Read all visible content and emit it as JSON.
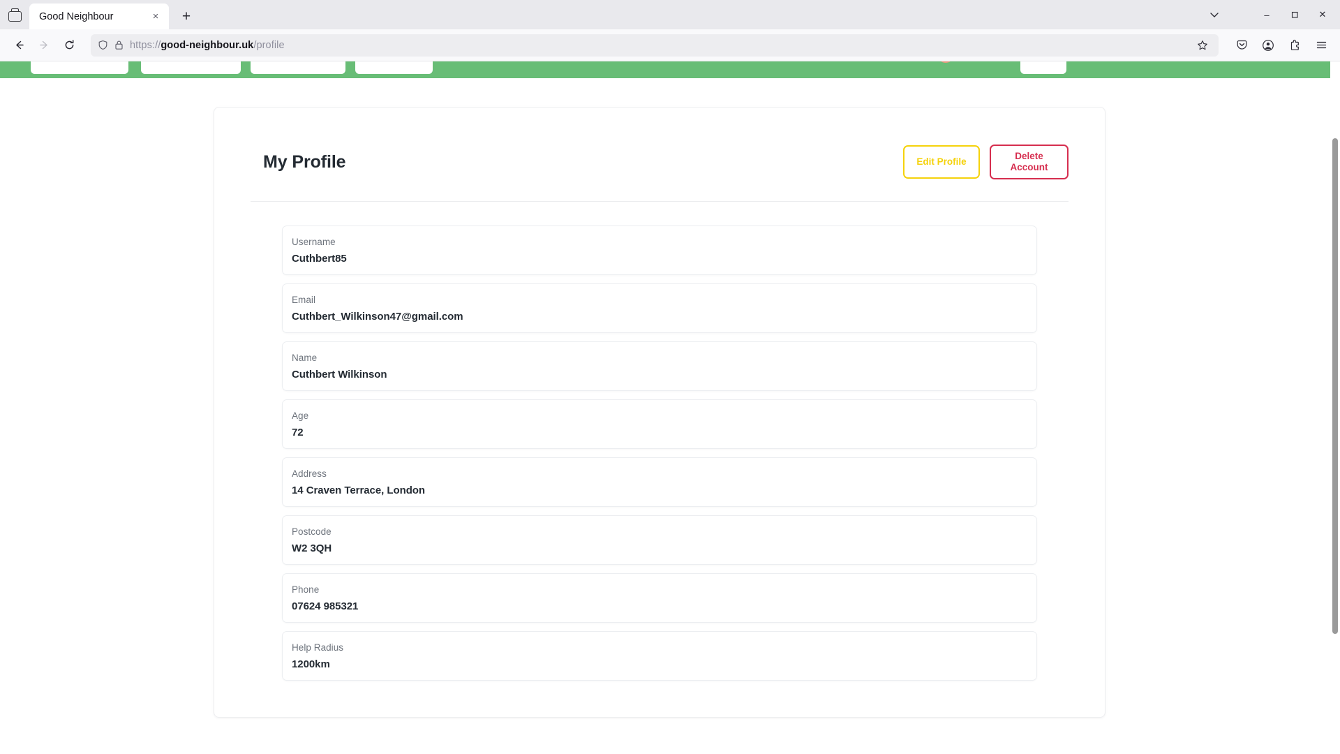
{
  "browser": {
    "tab": {
      "title": "Good Neighbour",
      "close_label": "×"
    },
    "new_tab_label": "+",
    "firefox_view_icon": "firefox-view-icon",
    "back_icon": "back-arrow-icon",
    "forward_icon": "forward-arrow-icon",
    "reload_icon": "reload-icon",
    "shield_icon": "shield-icon",
    "lock_icon": "padlock-icon",
    "url": {
      "scheme": "https://",
      "host": "good-neighbour.uk",
      "path": "/profile"
    },
    "bookmark_icon": "star-icon",
    "save_to_pocket_icon": "pocket-icon",
    "account_icon": "account-icon",
    "extensions_icon": "extensions-icon",
    "menu_icon": "hamburger-menu-icon",
    "window_controls": {
      "list_all_tabs": "chevron-down-icon",
      "minimize": "–",
      "maximize": "❐",
      "close": "✕"
    }
  },
  "site": {
    "header_color": "#68bd76",
    "avatar_color": "#ef9a7d"
  },
  "main": {
    "title": "My Profile",
    "actions": {
      "edit": {
        "label": "Edit Profile",
        "color": "#f5d20c"
      },
      "delete": {
        "label": "Delete Account",
        "color": "#d62e4f"
      }
    },
    "fields": [
      {
        "label": "Username",
        "value": "Cuthbert85"
      },
      {
        "label": "Email",
        "value": "Cuthbert_Wilkinson47@gmail.com"
      },
      {
        "label": "Name",
        "value": "Cuthbert Wilkinson"
      },
      {
        "label": "Age",
        "value": "72"
      },
      {
        "label": "Address",
        "value": "14 Craven Terrace, London"
      },
      {
        "label": "Postcode",
        "value": "W2 3QH"
      },
      {
        "label": "Phone",
        "value": "07624 985321"
      },
      {
        "label": "Help Radius",
        "value": "1200km"
      }
    ]
  }
}
